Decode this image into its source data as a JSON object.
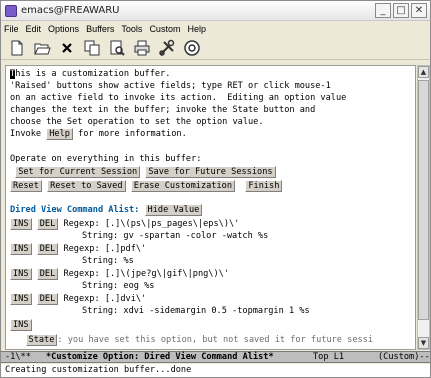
{
  "window": {
    "title": "emacs@FREAWARU",
    "minimize": "_",
    "maximize": "□",
    "close": "✕"
  },
  "menu": [
    "File",
    "Edit",
    "Options",
    "Buffers",
    "Tools",
    "Custom",
    "Help"
  ],
  "toolbar": [
    "new-file-icon",
    "open-folder-icon",
    "close-icon",
    "copy-icon",
    "find-icon",
    "print-icon",
    "tools-icon",
    "help-icon"
  ],
  "buffer": {
    "cursor_char": "T",
    "intro": [
      "his is a customization buffer.",
      "'Raised' buttons show active fields; type RET or click mouse-1",
      "on an active field to invoke its action.  Editing an option value",
      "changes the text in the buffer; invoke the State button and",
      "choose the Set operation to set the option value."
    ],
    "invoke_prefix": "Invoke ",
    "help_button": "Help",
    "invoke_suffix": " for more information.",
    "operate_heading": "Operate on everything in this buffer:",
    "set_session": "Set for Current Session",
    "save_future": "Save for Future Sessions",
    "reset": "Reset",
    "reset_saved": "Reset to Saved",
    "erase": "Erase Customization",
    "finish": "Finish",
    "option_heading": "Dired View Command Alist:",
    "hide_value": "Hide Value",
    "ins": "INS",
    "del": "DEL",
    "entries": [
      {
        "regexp": "Regexp: [.]\\(ps\\|ps_pages\\|eps\\)\\'",
        "string": "String: gv -spartan -color -watch %s"
      },
      {
        "regexp": "Regexp: [.]pdf\\'",
        "string": "String: %s"
      },
      {
        "regexp": "Regexp: [.]\\(jpe?g\\|gif\\|png\\)\\'",
        "string": "String: eog %s"
      },
      {
        "regexp": "Regexp: [.]dvi\\'",
        "string": "String: xdvi -sidemargin 0.5 -topmargin 1 %s"
      }
    ],
    "state_button": "State",
    "state_text": ": you have set this option, but not saved it for future sessi"
  },
  "modeline": {
    "status": "-1\\**",
    "buffer_name": "*Customize Option: Dired View Command Alist*",
    "position": "Top L1",
    "mode": "(Custom)--"
  },
  "minibuffer": "Creating customization buffer...done",
  "colors": {
    "heading": "#005a9c",
    "button_face": "#d4d0c8",
    "modeline": "#bdbdbd"
  }
}
